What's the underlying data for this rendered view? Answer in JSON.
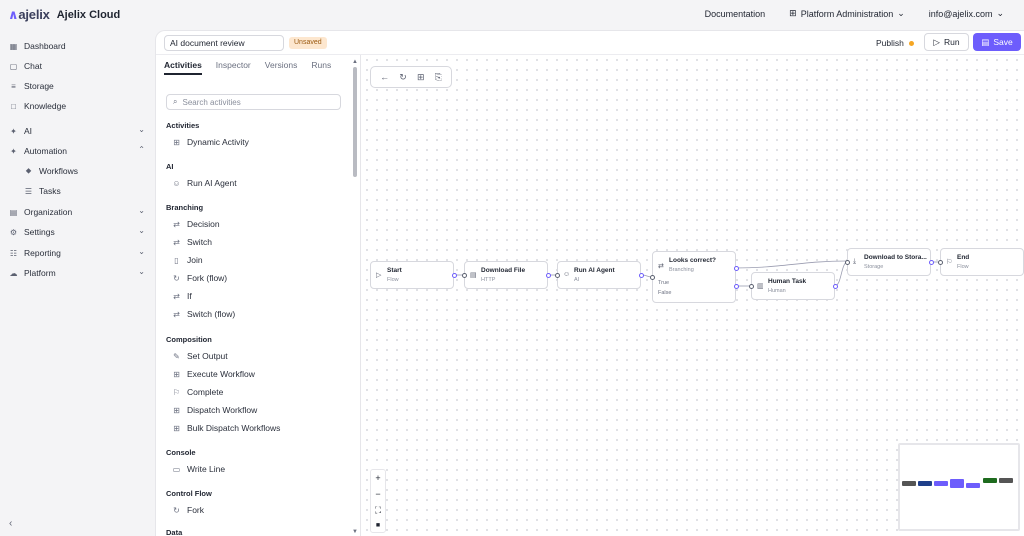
{
  "brand": {
    "logo": "ajelix",
    "name": "Ajelix Cloud"
  },
  "topnav": {
    "documentation": "Documentation",
    "platform_admin": "Platform Administration",
    "user_email": "info@ajelix.com"
  },
  "sidebar": {
    "items": [
      {
        "label": "Dashboard",
        "icon": "dashboard-icon"
      },
      {
        "label": "Chat",
        "icon": "chat-icon"
      },
      {
        "label": "Storage",
        "icon": "storage-icon"
      },
      {
        "label": "Knowledge",
        "icon": "book-icon"
      },
      {
        "label": "AI",
        "icon": "ai-icon"
      },
      {
        "label": "Automation",
        "icon": "automation-icon"
      },
      {
        "label": "Workflows",
        "icon": "workflow-icon"
      },
      {
        "label": "Tasks",
        "icon": "tasks-icon"
      },
      {
        "label": "Organization",
        "icon": "organization-icon"
      },
      {
        "label": "Settings",
        "icon": "gear-icon"
      },
      {
        "label": "Reporting",
        "icon": "reporting-icon"
      },
      {
        "label": "Platform",
        "icon": "cloud-icon"
      }
    ]
  },
  "editor": {
    "workflow_name": "AI document review",
    "status_badge": "Unsaved",
    "publish_label": "Publish",
    "run_label": "Run",
    "save_label": "Save"
  },
  "panel": {
    "tabs": [
      "Activities",
      "Inspector",
      "Versions",
      "Runs"
    ],
    "search_placeholder": "Search activities",
    "sections": [
      {
        "title": "Activities",
        "items": [
          "Dynamic Activity"
        ]
      },
      {
        "title": "AI",
        "items": [
          "Run AI Agent"
        ]
      },
      {
        "title": "Branching",
        "items": [
          "Decision",
          "Switch",
          "Join",
          "Fork (flow)",
          "If",
          "Switch (flow)"
        ]
      },
      {
        "title": "Composition",
        "items": [
          "Set Output",
          "Execute Workflow",
          "Complete",
          "Dispatch Workflow",
          "Bulk Dispatch Workflows"
        ]
      },
      {
        "title": "Console",
        "items": [
          "Write Line"
        ]
      },
      {
        "title": "Control Flow",
        "items": [
          "Fork"
        ]
      },
      {
        "title": "Data",
        "items": []
      }
    ]
  },
  "nodes": [
    {
      "title": "Start",
      "sub": "Flow"
    },
    {
      "title": "Download File",
      "sub": "HTTP"
    },
    {
      "title": "Run AI Agent",
      "sub": "AI"
    },
    {
      "title": "Looks correct?",
      "sub": "Branching",
      "ports": [
        "True",
        "False"
      ]
    },
    {
      "title": "Human Task",
      "sub": "Human"
    },
    {
      "title": "Download to Stora...",
      "sub": "Storage"
    },
    {
      "title": "End",
      "sub": "Flow"
    }
  ],
  "colors": {
    "accent": "#6d5dfc",
    "badge_bg": "#fde7cf",
    "publish_dot": "#f5a623"
  }
}
